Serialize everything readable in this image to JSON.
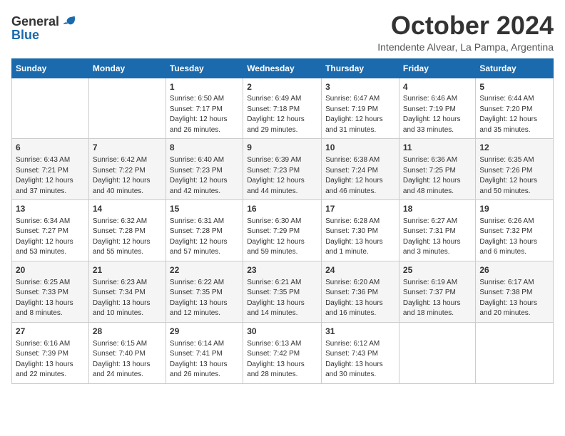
{
  "logo": {
    "general": "General",
    "blue": "Blue"
  },
  "title": "October 2024",
  "subtitle": "Intendente Alvear, La Pampa, Argentina",
  "days_of_week": [
    "Sunday",
    "Monday",
    "Tuesday",
    "Wednesday",
    "Thursday",
    "Friday",
    "Saturday"
  ],
  "weeks": [
    [
      {
        "day": "",
        "content": ""
      },
      {
        "day": "",
        "content": ""
      },
      {
        "day": "1",
        "content": "Sunrise: 6:50 AM\nSunset: 7:17 PM\nDaylight: 12 hours\nand 26 minutes."
      },
      {
        "day": "2",
        "content": "Sunrise: 6:49 AM\nSunset: 7:18 PM\nDaylight: 12 hours\nand 29 minutes."
      },
      {
        "day": "3",
        "content": "Sunrise: 6:47 AM\nSunset: 7:19 PM\nDaylight: 12 hours\nand 31 minutes."
      },
      {
        "day": "4",
        "content": "Sunrise: 6:46 AM\nSunset: 7:19 PM\nDaylight: 12 hours\nand 33 minutes."
      },
      {
        "day": "5",
        "content": "Sunrise: 6:44 AM\nSunset: 7:20 PM\nDaylight: 12 hours\nand 35 minutes."
      }
    ],
    [
      {
        "day": "6",
        "content": "Sunrise: 6:43 AM\nSunset: 7:21 PM\nDaylight: 12 hours\nand 37 minutes."
      },
      {
        "day": "7",
        "content": "Sunrise: 6:42 AM\nSunset: 7:22 PM\nDaylight: 12 hours\nand 40 minutes."
      },
      {
        "day": "8",
        "content": "Sunrise: 6:40 AM\nSunset: 7:23 PM\nDaylight: 12 hours\nand 42 minutes."
      },
      {
        "day": "9",
        "content": "Sunrise: 6:39 AM\nSunset: 7:23 PM\nDaylight: 12 hours\nand 44 minutes."
      },
      {
        "day": "10",
        "content": "Sunrise: 6:38 AM\nSunset: 7:24 PM\nDaylight: 12 hours\nand 46 minutes."
      },
      {
        "day": "11",
        "content": "Sunrise: 6:36 AM\nSunset: 7:25 PM\nDaylight: 12 hours\nand 48 minutes."
      },
      {
        "day": "12",
        "content": "Sunrise: 6:35 AM\nSunset: 7:26 PM\nDaylight: 12 hours\nand 50 minutes."
      }
    ],
    [
      {
        "day": "13",
        "content": "Sunrise: 6:34 AM\nSunset: 7:27 PM\nDaylight: 12 hours\nand 53 minutes."
      },
      {
        "day": "14",
        "content": "Sunrise: 6:32 AM\nSunset: 7:28 PM\nDaylight: 12 hours\nand 55 minutes."
      },
      {
        "day": "15",
        "content": "Sunrise: 6:31 AM\nSunset: 7:28 PM\nDaylight: 12 hours\nand 57 minutes."
      },
      {
        "day": "16",
        "content": "Sunrise: 6:30 AM\nSunset: 7:29 PM\nDaylight: 12 hours\nand 59 minutes."
      },
      {
        "day": "17",
        "content": "Sunrise: 6:28 AM\nSunset: 7:30 PM\nDaylight: 13 hours\nand 1 minute."
      },
      {
        "day": "18",
        "content": "Sunrise: 6:27 AM\nSunset: 7:31 PM\nDaylight: 13 hours\nand 3 minutes."
      },
      {
        "day": "19",
        "content": "Sunrise: 6:26 AM\nSunset: 7:32 PM\nDaylight: 13 hours\nand 6 minutes."
      }
    ],
    [
      {
        "day": "20",
        "content": "Sunrise: 6:25 AM\nSunset: 7:33 PM\nDaylight: 13 hours\nand 8 minutes."
      },
      {
        "day": "21",
        "content": "Sunrise: 6:23 AM\nSunset: 7:34 PM\nDaylight: 13 hours\nand 10 minutes."
      },
      {
        "day": "22",
        "content": "Sunrise: 6:22 AM\nSunset: 7:35 PM\nDaylight: 13 hours\nand 12 minutes."
      },
      {
        "day": "23",
        "content": "Sunrise: 6:21 AM\nSunset: 7:35 PM\nDaylight: 13 hours\nand 14 minutes."
      },
      {
        "day": "24",
        "content": "Sunrise: 6:20 AM\nSunset: 7:36 PM\nDaylight: 13 hours\nand 16 minutes."
      },
      {
        "day": "25",
        "content": "Sunrise: 6:19 AM\nSunset: 7:37 PM\nDaylight: 13 hours\nand 18 minutes."
      },
      {
        "day": "26",
        "content": "Sunrise: 6:17 AM\nSunset: 7:38 PM\nDaylight: 13 hours\nand 20 minutes."
      }
    ],
    [
      {
        "day": "27",
        "content": "Sunrise: 6:16 AM\nSunset: 7:39 PM\nDaylight: 13 hours\nand 22 minutes."
      },
      {
        "day": "28",
        "content": "Sunrise: 6:15 AM\nSunset: 7:40 PM\nDaylight: 13 hours\nand 24 minutes."
      },
      {
        "day": "29",
        "content": "Sunrise: 6:14 AM\nSunset: 7:41 PM\nDaylight: 13 hours\nand 26 minutes."
      },
      {
        "day": "30",
        "content": "Sunrise: 6:13 AM\nSunset: 7:42 PM\nDaylight: 13 hours\nand 28 minutes."
      },
      {
        "day": "31",
        "content": "Sunrise: 6:12 AM\nSunset: 7:43 PM\nDaylight: 13 hours\nand 30 minutes."
      },
      {
        "day": "",
        "content": ""
      },
      {
        "day": "",
        "content": ""
      }
    ]
  ]
}
